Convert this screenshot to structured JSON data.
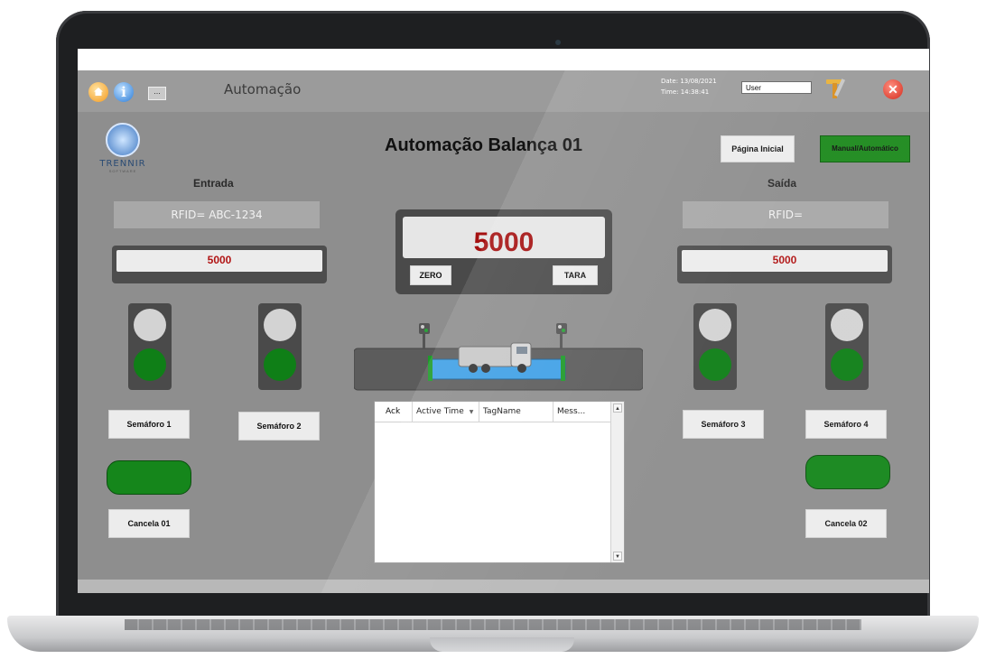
{
  "titlebar": {
    "app_title": "Automação",
    "dots_label": "...",
    "date_label": "Date:  13/08/2021",
    "time_label": "Time:  14:38:41",
    "user_value": "User",
    "close_glyph": "✕"
  },
  "logo": {
    "text": "TRENNIR",
    "subtext": "SOFTWARE"
  },
  "main_title": "Automação Balança 01",
  "nav": {
    "home_label": "Página Inicial",
    "mode_label": "Manual/Automático"
  },
  "entrada": {
    "title": "Entrada",
    "rfid": "RFID= ABC-1234",
    "weight": "5000",
    "semaforo1_label": "Semáforo 1",
    "semaforo2_label": "Semáforo 2",
    "cancela_label": "Cancela 01"
  },
  "saida": {
    "title": "Saída",
    "rfid": "RFID=",
    "weight": "5000",
    "semaforo3_label": "Semáforo 3",
    "semaforo4_label": "Semáforo 4",
    "cancela_label": "Cancela 02"
  },
  "scale": {
    "value": "5000",
    "zero_label": "ZERO",
    "tara_label": "TARA"
  },
  "alarm_table": {
    "columns": [
      "Ack",
      "Active Time",
      "TagName",
      "Mess..."
    ]
  },
  "colors": {
    "accent_green": "#1d8a1d",
    "weight_red": "#a51111",
    "panel_gray": "#8e8e8e"
  },
  "icons": [
    "home-icon",
    "info-icon",
    "tools-icon",
    "close-icon",
    "truck-icon"
  ]
}
